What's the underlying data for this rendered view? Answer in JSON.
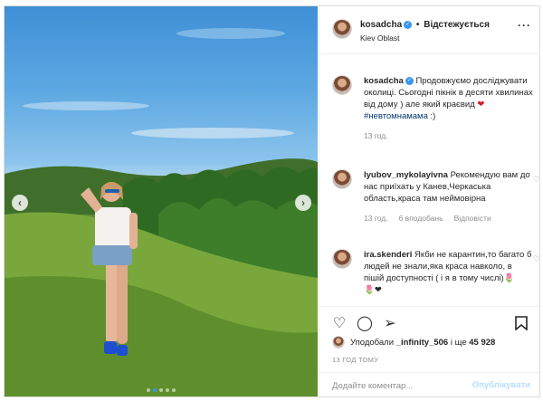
{
  "post": {
    "username": "kosadcha",
    "follow_separator": "•",
    "follow_label": "Відстежується",
    "location": "Kiev Oblast",
    "more_icon": "more-horizontal-icon"
  },
  "caption": {
    "username": "kosadcha",
    "text_1": "Продовжуємо досліджувати околиці. Сьогодні пікнік в десяти хвилинах від дому ) але який краєвид",
    "emoji": "❤",
    "hashtag": "#невтомнамама",
    "text_2": ":)",
    "time": "13 год."
  },
  "comments": [
    {
      "username": "lyubov_mykolayivna",
      "text": "Рекомендую вам до нас приїхать у Канев,Черкаська область,краса там неймовірна",
      "time": "13 год.",
      "likes": "6 вподобань",
      "reply": "Відповісти"
    },
    {
      "username": "ira.skenderi",
      "text": "Якби не карантин,то багато б людей не знали,яка краса навколо, в пішій доступності ( і я в тому числі)🌷",
      "emoji_row": "🌷❤"
    }
  ],
  "actions": {
    "liked_prefix": "Уподобали",
    "liked_user": "_infinity_506",
    "liked_middle": "і ще",
    "liked_count": "45 928",
    "timestamp": "13 ГОД ТОМУ",
    "comment_placeholder": "Додайте коментар...",
    "publish_label": "Опублікувати"
  },
  "carousel": {
    "prev_label": "‹",
    "next_label": "›",
    "active_index": 1,
    "count": 5
  },
  "colors": {
    "link": "#00376b",
    "verified": "#3897f0",
    "publish_disabled": "#b2dffc",
    "meta": "#8e8e8e"
  }
}
